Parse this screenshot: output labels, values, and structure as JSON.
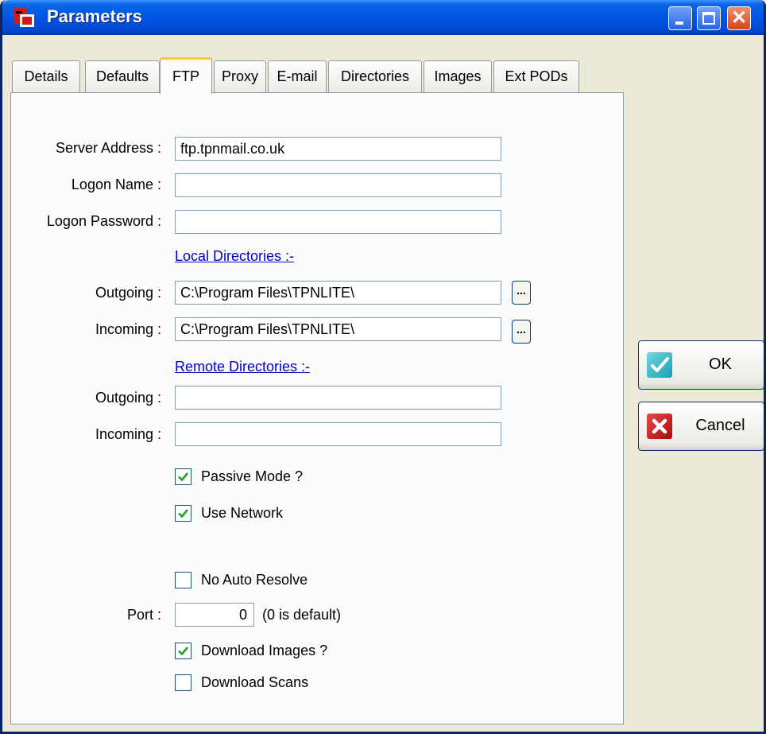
{
  "window": {
    "title": "Parameters"
  },
  "titlebar_buttons": {
    "close_glyph": "✕"
  },
  "tabs": [
    {
      "label": "Details"
    },
    {
      "label": "Defaults"
    },
    {
      "label": "FTP",
      "active": true
    },
    {
      "label": "Proxy"
    },
    {
      "label": "E-mail"
    },
    {
      "label": "Directories"
    },
    {
      "label": "Images"
    },
    {
      "label": "Ext PODs"
    }
  ],
  "form": {
    "server_address": {
      "label": "Server Address :",
      "value": "ftp.tpnmail.co.uk"
    },
    "logon_name": {
      "label": "Logon Name :",
      "value": ""
    },
    "logon_password": {
      "label": "Logon Password :",
      "value": ""
    },
    "local_directories_link": "Local Directories :-",
    "local_outgoing": {
      "label": "Outgoing :",
      "value": "C:\\Program Files\\TPNLITE\\"
    },
    "local_incoming": {
      "label": "Incoming :",
      "value": "C:\\Program Files\\TPNLITE\\"
    },
    "browse_label": "...",
    "remote_directories_link": "Remote Directories :-",
    "remote_outgoing": {
      "label": "Outgoing :",
      "value": ""
    },
    "remote_incoming": {
      "label": "Incoming :",
      "value": ""
    },
    "passive_mode": {
      "label": "Passive Mode ?",
      "checked": true
    },
    "use_network": {
      "label": "Use Network",
      "checked": true
    },
    "no_auto_resolve": {
      "label": "No Auto Resolve",
      "checked": false
    },
    "port": {
      "label": "Port :",
      "value": "0",
      "hint": "(0 is default)"
    },
    "download_images": {
      "label": "Download Images ?",
      "checked": true
    },
    "download_scans": {
      "label": "Download Scans",
      "checked": false
    }
  },
  "buttons": {
    "ok": "OK",
    "cancel": "Cancel"
  },
  "colors": {
    "title_bar": "#0055e5",
    "link": "#0000c8",
    "check_mark": "#21a121",
    "ok_icon": "#26b2c2",
    "cancel_icon": "#c81414"
  }
}
